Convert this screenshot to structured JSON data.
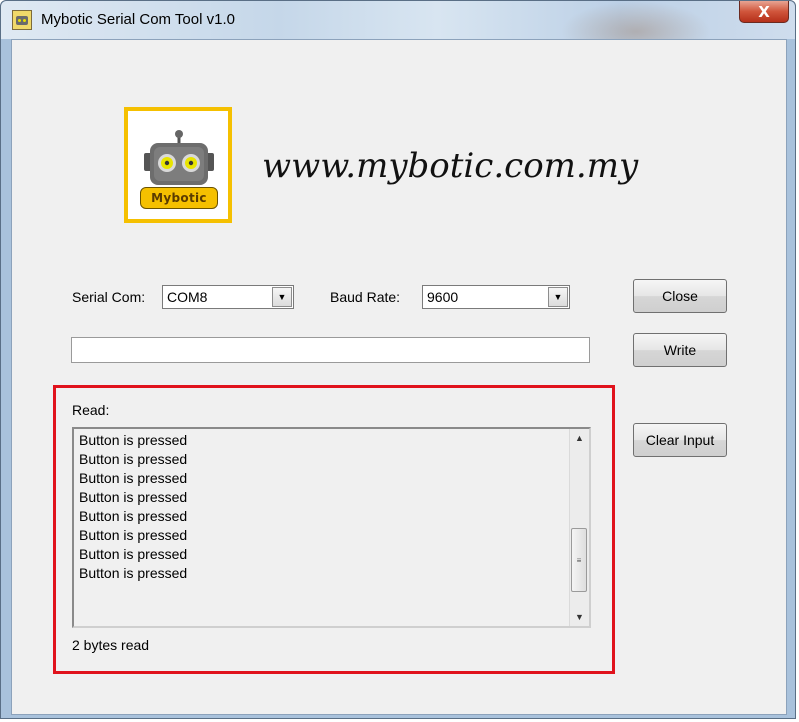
{
  "window": {
    "title": "Mybotic Serial Com Tool v1.0",
    "close_glyph": "X"
  },
  "brand": {
    "logo_text": "Mybotic",
    "website": "www.mybotic.com.my"
  },
  "serial": {
    "label": "Serial Com:",
    "selected": "COM8"
  },
  "baud": {
    "label": "Baud Rate:",
    "selected": "9600"
  },
  "write": {
    "value": ""
  },
  "buttons": {
    "close": "Close",
    "write": "Write",
    "clear_input": "Clear Input"
  },
  "read": {
    "label": "Read:",
    "lines": [
      "Button is pressed",
      "Button is pressed",
      "Button is pressed",
      "Button is pressed",
      "Button is pressed",
      "Button is pressed",
      "Button is pressed",
      "Button is pressed"
    ],
    "status": "2 bytes read"
  },
  "colors": {
    "highlight": "#e0121c",
    "logo_accent": "#f5c000"
  },
  "icons": {
    "app": "robot-icon",
    "dropdown": "chevron-down-icon",
    "scroll_up": "arrow-up-icon",
    "scroll_down": "arrow-down-icon"
  }
}
